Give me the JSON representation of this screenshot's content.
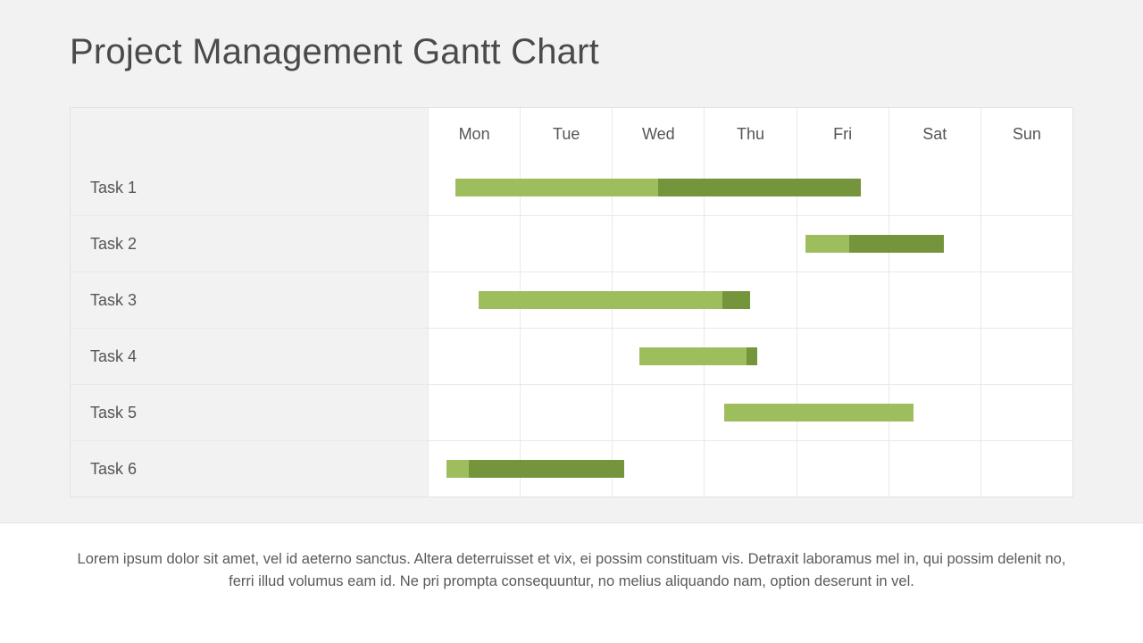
{
  "title": "Project Management Gantt Chart",
  "days": [
    "Mon",
    "Tue",
    "Wed",
    "Thu",
    "Fri",
    "Sat",
    "Sun"
  ],
  "tasks": [
    {
      "name": "Task 1",
      "start": 0.3,
      "light": 2.2,
      "dark": 2.2
    },
    {
      "name": "Task 2",
      "start": 4.1,
      "light": 0.48,
      "dark": 1.02
    },
    {
      "name": "Task 3",
      "start": 0.55,
      "light": 2.65,
      "dark": 0.3
    },
    {
      "name": "Task 4",
      "start": 2.3,
      "light": 1.16,
      "dark": 0.12
    },
    {
      "name": "Task 5",
      "start": 3.22,
      "light": 2.05,
      "dark": 0.0
    },
    {
      "name": "Task 6",
      "start": 0.2,
      "light": 0.25,
      "dark": 1.68
    }
  ],
  "footer_text": "Lorem ipsum dolor sit amet, vel id aeterno sanctus. Altera deterruisset et vix, ei possim constituam vis. Detraxit laboramus mel in, qui possim delenit no, ferri illud volumus eam id. Ne pri prompta consequuntur, no melius aliquando nam, option deserunt in vel.",
  "colors": {
    "light": "#9ebe5e",
    "dark": "#74953b"
  },
  "chart_data": {
    "type": "bar",
    "title": "Project Management Gantt Chart",
    "categories": [
      "Mon",
      "Tue",
      "Wed",
      "Thu",
      "Fri",
      "Sat",
      "Sun"
    ],
    "series": [
      {
        "name": "Task 1",
        "start_day": "Mon",
        "segment1_days": 2.2,
        "segment2_days": 2.2
      },
      {
        "name": "Task 2",
        "start_day": "Fri",
        "segment1_days": 0.5,
        "segment2_days": 1.0
      },
      {
        "name": "Task 3",
        "start_day": "Mon",
        "segment1_days": 2.6,
        "segment2_days": 0.3
      },
      {
        "name": "Task 4",
        "start_day": "Wed",
        "segment1_days": 1.2,
        "segment2_days": 0.1
      },
      {
        "name": "Task 5",
        "start_day": "Thu",
        "segment1_days": 2.0,
        "segment2_days": 0.0
      },
      {
        "name": "Task 6",
        "start_day": "Mon",
        "segment1_days": 0.3,
        "segment2_days": 1.7
      }
    ],
    "xlabel": "",
    "ylabel": "",
    "legend": [
      "light green segment",
      "dark green segment"
    ]
  }
}
